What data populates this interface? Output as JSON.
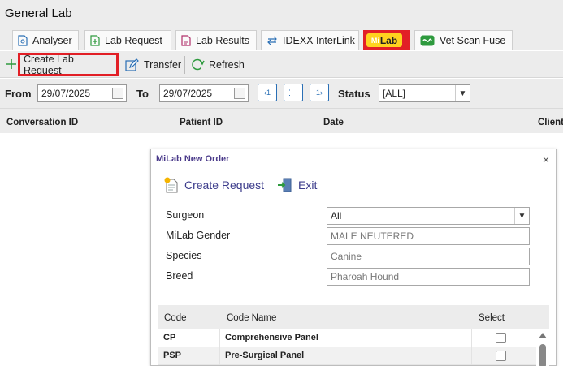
{
  "app": {
    "title": "General Lab"
  },
  "tabs": [
    {
      "label": "Analyser",
      "icon": "analyser-icon"
    },
    {
      "label": "Lab Request",
      "icon": "lab-request-icon"
    },
    {
      "label": "Lab Results",
      "icon": "lab-results-icon"
    },
    {
      "label": "IDEXX InterLink",
      "icon": "exchange-arrows-icon"
    },
    {
      "label": "Lab",
      "prefix": "Mi",
      "icon": "milab-logo"
    },
    {
      "label": "Vet Scan Fuse",
      "icon": "vetscan-icon"
    }
  ],
  "toolbar": {
    "create_label": "Create Lab Request",
    "transfer_label": "Transfer",
    "refresh_label": "Refresh"
  },
  "filters": {
    "from_label": "From",
    "from_value": "29/07/2025",
    "to_label": "To",
    "to_value": "29/07/2025",
    "status_label": "Status",
    "status_value": "[ALL]"
  },
  "grid": {
    "columns": [
      "Conversation ID",
      "Patient ID",
      "Date",
      "Client"
    ]
  },
  "dialog": {
    "title": "MiLab New Order",
    "create_label": "Create Request",
    "exit_label": "Exit",
    "fields": {
      "surgeon_label": "Surgeon",
      "surgeon_value": "All",
      "gender_label": "MiLab Gender",
      "gender_value": "MALE NEUTERED",
      "species_label": "Species",
      "species_value": "Canine",
      "breed_label": "Breed",
      "breed_value": "Pharoah Hound"
    },
    "table": {
      "columns": [
        "Code",
        "Code Name",
        "Select"
      ],
      "rows": [
        {
          "code": "CP",
          "name": "Comprehensive Panel"
        },
        {
          "code": "PSP",
          "name": "Pre-Surgical Panel"
        }
      ]
    }
  },
  "colors": {
    "highlight": "#e21f26",
    "milab_yellow": "#ffd21f",
    "toolbar_green": "#2e9a3e",
    "link_blue": "#2a6fb5",
    "dialog_purple": "#4a3a8a"
  }
}
